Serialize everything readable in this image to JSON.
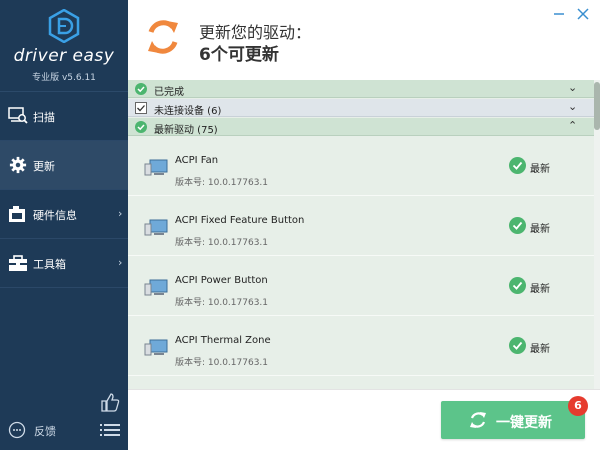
{
  "app": {
    "brand": "driver easy",
    "edition": "专业版 v5.6.11"
  },
  "sidebar": {
    "items": [
      {
        "label": "扫描",
        "icon": "scan-icon",
        "active": false
      },
      {
        "label": "更新",
        "icon": "gear-icon",
        "active": true
      },
      {
        "label": "硬件信息",
        "icon": "hardware-icon",
        "active": false
      },
      {
        "label": "工具箱",
        "icon": "toolbox-icon",
        "active": false
      }
    ],
    "feedback_label": "反馈"
  },
  "header": {
    "line1": "更新您的驱动：",
    "line2": "6个可更新"
  },
  "groups": [
    {
      "label": "已完成",
      "state": "collapsed",
      "icon": "check-circle-icon"
    },
    {
      "label": "未连接设备 (6)",
      "state": "collapsed",
      "icon": "checkbox-icon"
    },
    {
      "label": "最新驱动 (75)",
      "state": "expanded",
      "icon": "check-circle-icon"
    }
  ],
  "drivers": [
    {
      "name": "ACPI Fan",
      "version": "版本号: 10.0.17763.1",
      "status": "最新"
    },
    {
      "name": "ACPI Fixed Feature Button",
      "version": "版本号: 10.0.17763.1",
      "status": "最新"
    },
    {
      "name": "ACPI Power Button",
      "version": "版本号: 10.0.17763.1",
      "status": "最新"
    },
    {
      "name": "ACPI Thermal Zone",
      "version": "版本号: 10.0.17763.1",
      "status": "最新"
    }
  ],
  "footer": {
    "update_all_label": "一键更新",
    "badge_count": "6"
  },
  "colors": {
    "sidebar_bg": "#1e3a57",
    "accent_green": "#5cc48a",
    "orange": "#f0883e",
    "badge_red": "#e63b2e"
  }
}
